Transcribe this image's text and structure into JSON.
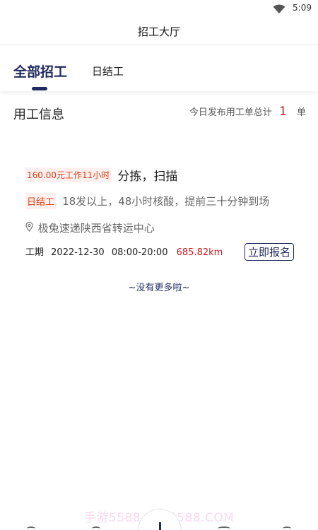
{
  "status_bar": {
    "time": "5:09",
    "wifi_icon": "wifi-icon"
  },
  "header": {
    "title": "招工大厅"
  },
  "tabs": [
    {
      "label": "全部招工",
      "active": true
    },
    {
      "label": "日结工",
      "active": false
    }
  ],
  "section": {
    "title": "用工信息",
    "total_label": "今日发布用工单总计",
    "total_count": "1",
    "total_unit": "单"
  },
  "job": {
    "pay_tag": "160.00元工作11小时",
    "name": "分拣，扫描",
    "type_tag": "日结工",
    "requirements": "18发以上，48小时核酸，提前三十分钟到场",
    "location": "极兔速递陕西省转运中心",
    "period_label": "工期",
    "date": "2022-12-30",
    "time_range": "08:00-20:00",
    "distance": "685.82km",
    "apply_label": "立即报名"
  },
  "no_more_text": "~没有更多啦~",
  "watermark": "手游5588 · KF5588.COM",
  "colors": {
    "accent": "#1e2a5e",
    "highlight_red": "#d11a1a",
    "tag_orange": "#d8431e",
    "tag_bg": "#fdf0ee"
  }
}
